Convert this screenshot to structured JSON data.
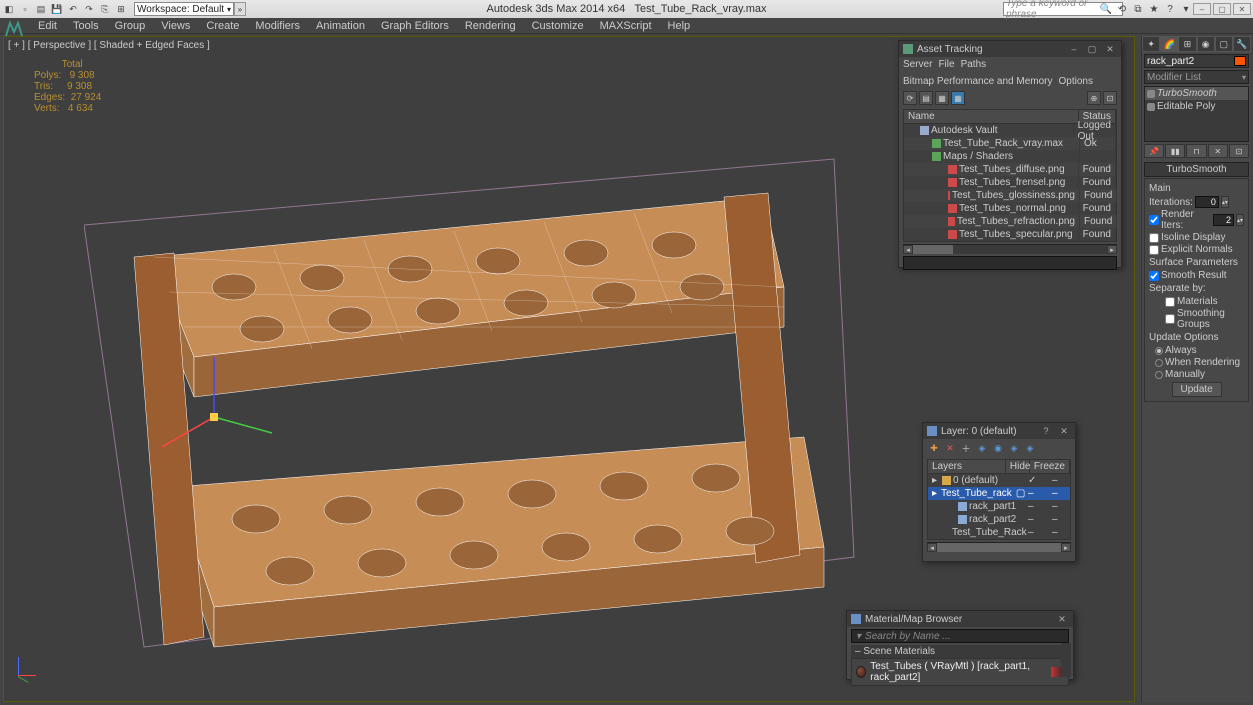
{
  "titlebar": {
    "app": "Autodesk 3ds Max  2014 x64",
    "file": "Test_Tube_Rack_vray.max",
    "workspace_label": "Workspace: Default",
    "search_placeholder": "Type a keyword or phrase"
  },
  "menu": [
    "Edit",
    "Tools",
    "Group",
    "Views",
    "Create",
    "Modifiers",
    "Animation",
    "Graph Editors",
    "Rendering",
    "Customize",
    "MAXScript",
    "Help"
  ],
  "viewport": {
    "label": "[ + ] [ Perspective ] [ Shaded + Edged Faces ]",
    "stats": {
      "title": "Total",
      "polys_label": "Polys:",
      "polys": "9 308",
      "tris_label": "Tris:",
      "tris": "9 308",
      "edges_label": "Edges:",
      "edges": "27 924",
      "verts_label": "Verts:",
      "verts": "4 634"
    }
  },
  "cmd": {
    "object_name": "rack_part2",
    "modifier_list_label": "Modifier List",
    "stack": [
      {
        "name": "TurboSmooth",
        "selected": true
      },
      {
        "name": "Editable Poly",
        "selected": false
      }
    ],
    "rollup_title": "TurboSmooth",
    "main": {
      "section": "Main",
      "iterations_label": "Iterations:",
      "iterations": "0",
      "render_iters_label": "Render Iters:",
      "render_iters": "2",
      "render_iters_checked": true,
      "isoline_label": "Isoline Display",
      "explicit_label": "Explicit Normals"
    },
    "surface": {
      "section": "Surface Parameters",
      "smooth_result_label": "Smooth Result",
      "smooth_result_checked": true,
      "separate_label": "Separate by:",
      "materials_label": "Materials",
      "smoothing_groups_label": "Smoothing Groups"
    },
    "update": {
      "section": "Update Options",
      "always": "Always",
      "when_rendering": "When Rendering",
      "manually": "Manually",
      "button": "Update"
    }
  },
  "asset": {
    "title": "Asset Tracking",
    "menu": [
      "Server",
      "File",
      "Paths",
      "Bitmap Performance and Memory",
      "Options"
    ],
    "cols": {
      "name": "Name",
      "status": "Status"
    },
    "rows": [
      {
        "indent": 1,
        "icon": "cloud",
        "name": "Autodesk Vault",
        "status": "Logged Out"
      },
      {
        "indent": 2,
        "icon": "max",
        "name": "Test_Tube_Rack_vray.max",
        "status": "Ok"
      },
      {
        "indent": 2,
        "icon": "shader",
        "name": "Maps / Shaders",
        "status": ""
      },
      {
        "indent": 3,
        "icon": "png",
        "name": "Test_Tubes_diffuse.png",
        "status": "Found"
      },
      {
        "indent": 3,
        "icon": "png",
        "name": "Test_Tubes_frensel.png",
        "status": "Found"
      },
      {
        "indent": 3,
        "icon": "png",
        "name": "Test_Tubes_glossiness.png",
        "status": "Found"
      },
      {
        "indent": 3,
        "icon": "png",
        "name": "Test_Tubes_normal.png",
        "status": "Found"
      },
      {
        "indent": 3,
        "icon": "png",
        "name": "Test_Tubes_refraction.png",
        "status": "Found"
      },
      {
        "indent": 3,
        "icon": "png",
        "name": "Test_Tubes_specular.png",
        "status": "Found"
      }
    ]
  },
  "layer": {
    "title": "Layer: 0 (default)",
    "cols": {
      "layers": "Layers",
      "hide": "Hide",
      "freeze": "Freeze"
    },
    "rows": [
      {
        "indent": 0,
        "icon": "layer",
        "name": "0 (default)",
        "selected": false,
        "checked": true
      },
      {
        "indent": 0,
        "icon": "layer",
        "name": "Test_Tube_rack",
        "selected": true,
        "checked": false
      },
      {
        "indent": 1,
        "icon": "obj",
        "name": "rack_part1",
        "selected": false
      },
      {
        "indent": 1,
        "icon": "obj",
        "name": "rack_part2",
        "selected": false
      },
      {
        "indent": 1,
        "icon": "obj",
        "name": "Test_Tube_Rack",
        "selected": false
      }
    ]
  },
  "material": {
    "title": "Material/Map Browser",
    "search_placeholder": "Search by Name ...",
    "section": "Scene Materials",
    "item": "Test_Tubes ( VRayMtl ) [rack_part1, rack_part2]"
  }
}
